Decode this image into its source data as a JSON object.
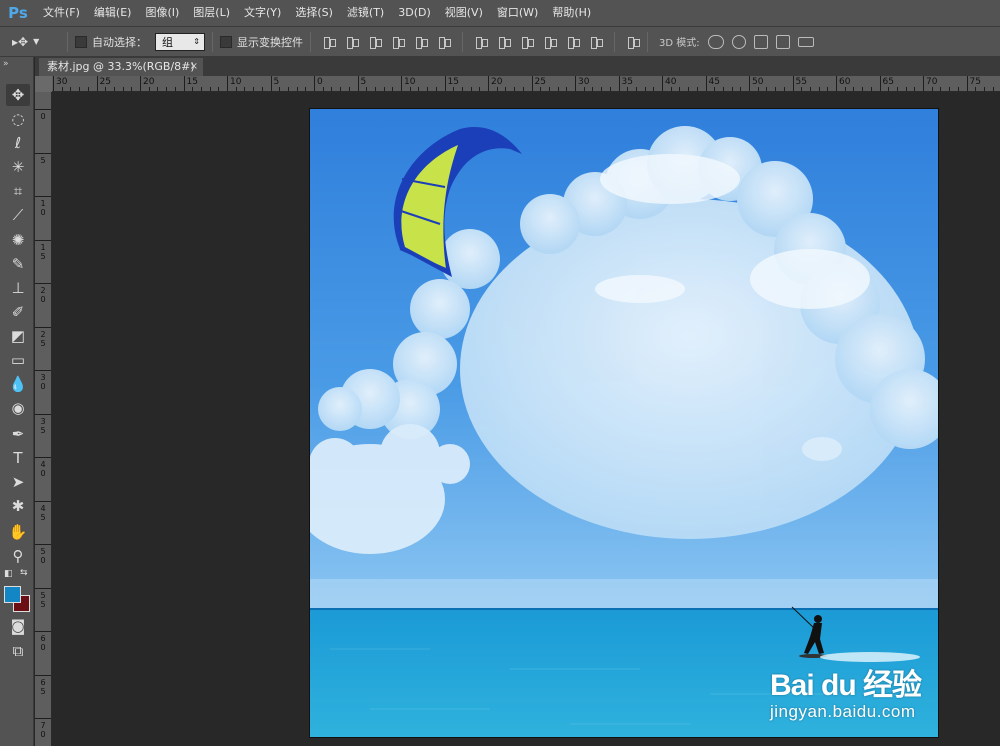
{
  "app": {
    "logo": "Ps"
  },
  "menu": [
    "文件(F)",
    "编辑(E)",
    "图像(I)",
    "图层(L)",
    "文字(Y)",
    "选择(S)",
    "滤镜(T)",
    "3D(D)",
    "视图(V)",
    "窗口(W)",
    "帮助(H)"
  ],
  "options": {
    "tool_icon": "move-tool-icon",
    "auto_select_label": "自动选择：",
    "auto_select_value": "组",
    "show_transform_label": "显示变换控件",
    "mode_3d_label": "3D 模式:"
  },
  "document": {
    "tab_title": "素材.jpg @ 33.3%(RGB/8#)",
    "close": "×"
  },
  "ruler": {
    "h_labels": [
      "30",
      "25",
      "20",
      "15",
      "10",
      "5",
      "0",
      "5",
      "10",
      "15",
      "20",
      "25",
      "30",
      "35",
      "40",
      "45",
      "50",
      "55",
      "60",
      "65",
      "70",
      "75"
    ],
    "v_labels": [
      "0",
      "5",
      "10",
      "15",
      "20",
      "25",
      "30",
      "35",
      "40",
      "45",
      "50",
      "55",
      "60",
      "65",
      "70"
    ]
  },
  "colors": {
    "foreground": "#1386c6",
    "background": "#6b0f14"
  },
  "watermark": {
    "main": "Bai du 经验",
    "sub": "jingyan.baidu.com"
  }
}
